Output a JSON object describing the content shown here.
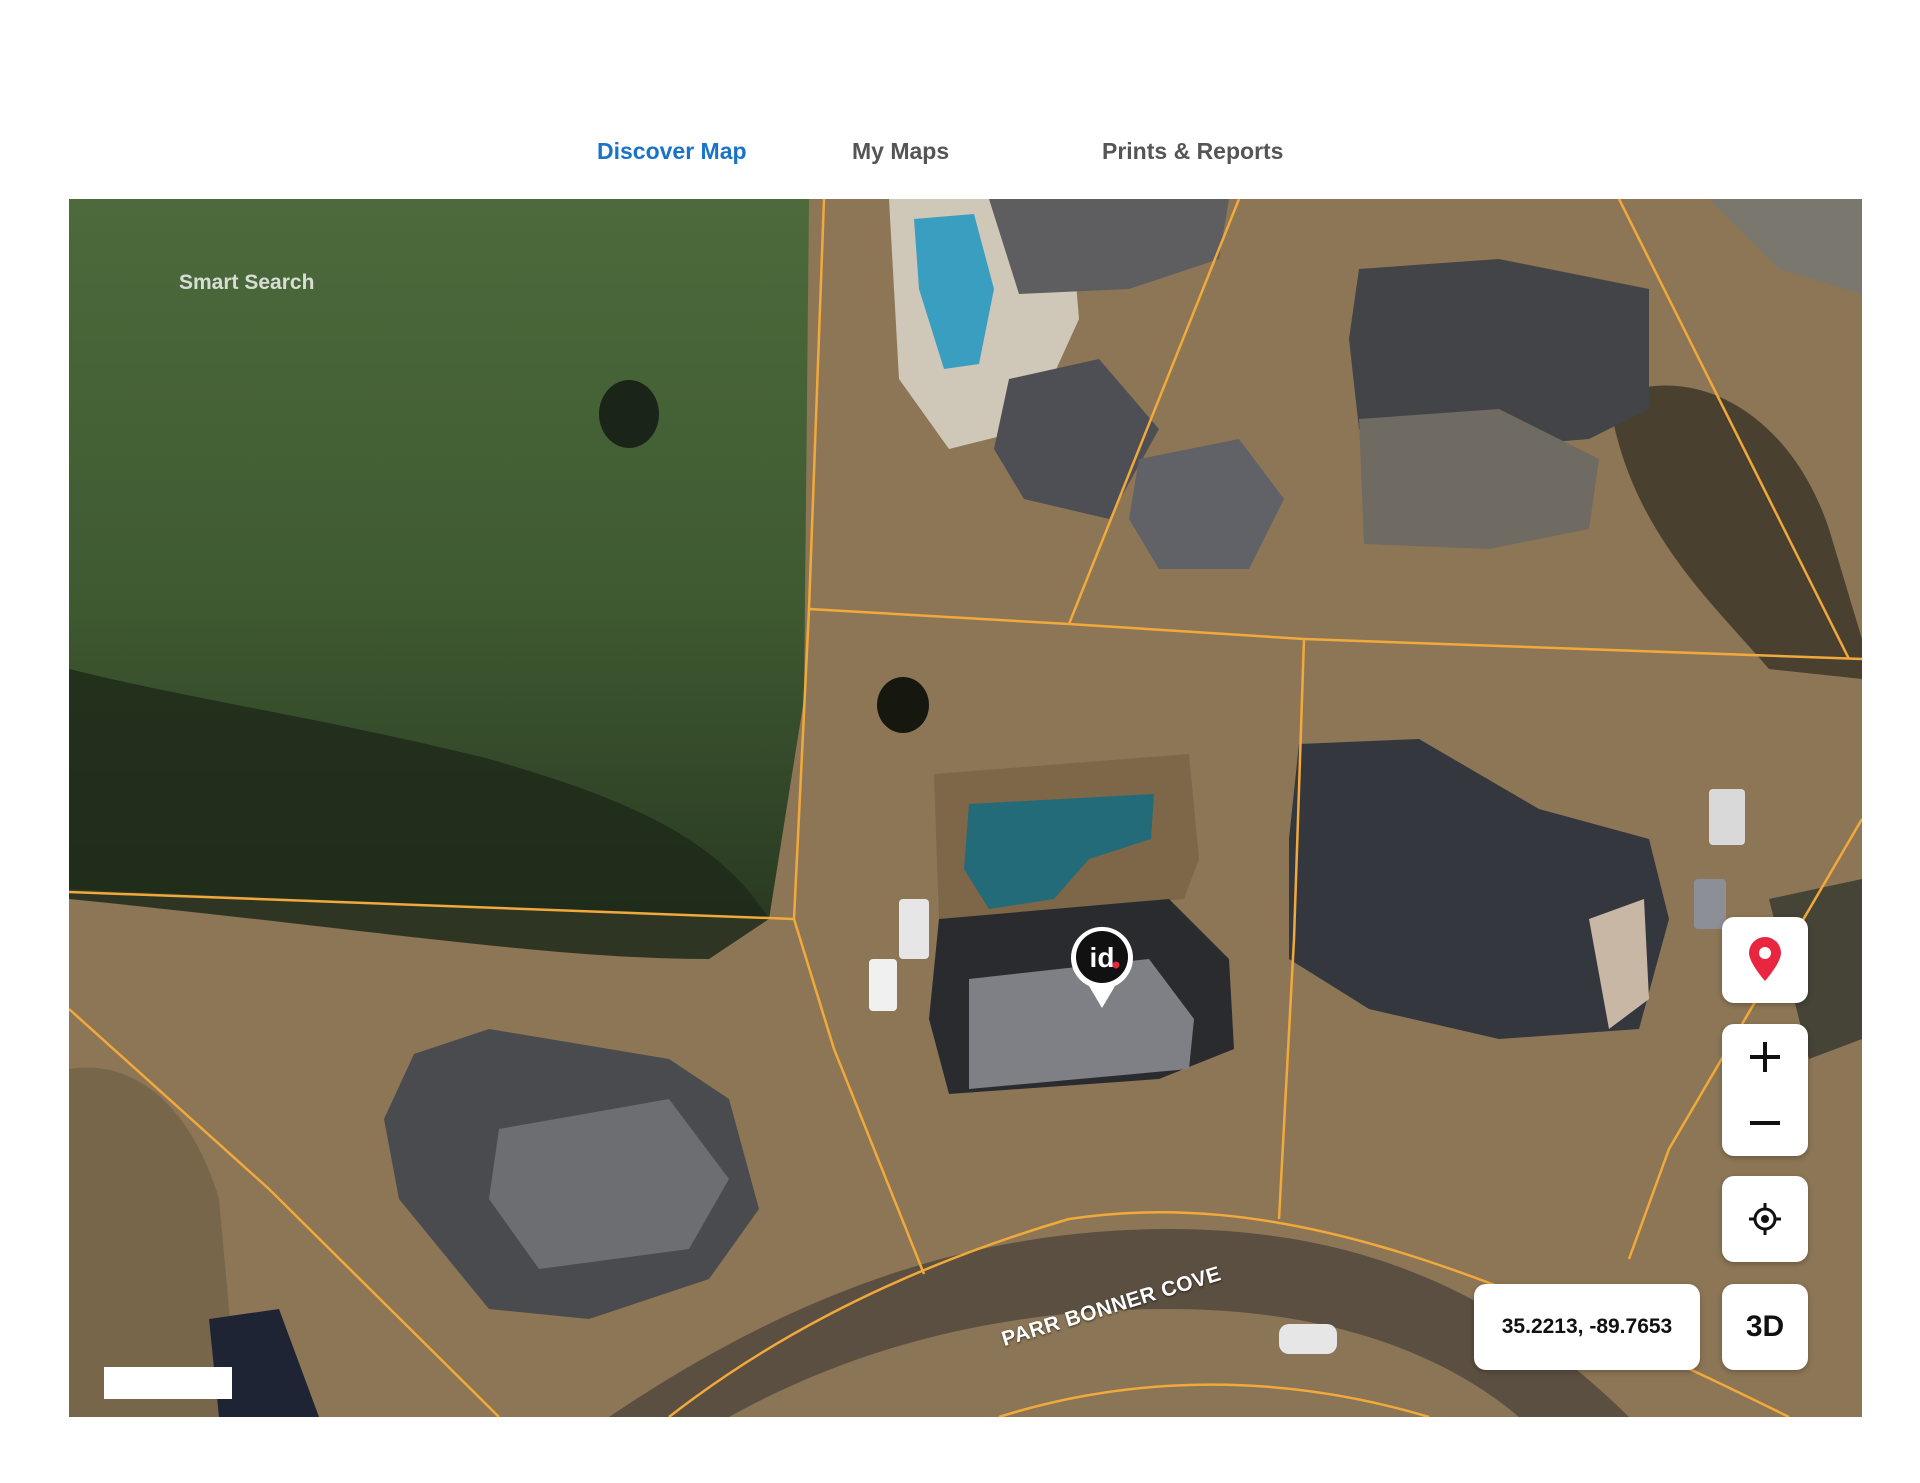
{
  "tabs": [
    {
      "label": "Discover Map",
      "active": true
    },
    {
      "label": "My Maps",
      "active": false
    },
    {
      "label": "Prints & Reports",
      "active": false
    }
  ],
  "map": {
    "search_placeholder": "Smart Search",
    "street_label": "PARR BONNER COVE",
    "coordinates": "35.2213, -89.7653",
    "view_mode_button": "3D",
    "marker_logo_text": "id",
    "parcel_line_color": "#f2a93b",
    "accent_color": "#1a73c8",
    "pin_color": "#e8263f",
    "controls": [
      "location-pin-icon",
      "zoom-in-icon",
      "zoom-out-icon",
      "locate-crosshair-icon"
    ]
  }
}
